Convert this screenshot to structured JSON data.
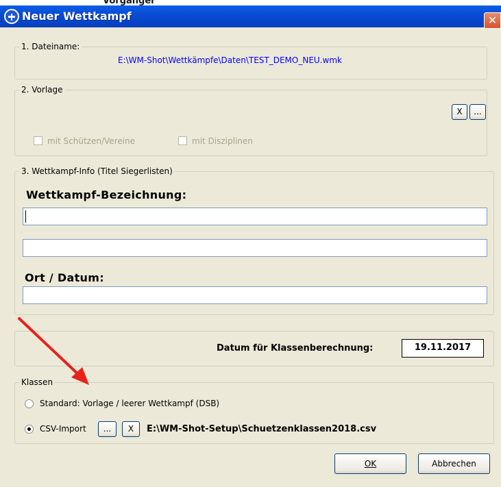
{
  "title_bar": {
    "title": "Neuer Wettkampf",
    "add_icon": "plus-circle-icon",
    "close_icon": "close-icon",
    "close_glyph": "✕",
    "top_cut_text": "Vorgänger"
  },
  "section1": {
    "legend": "1. Dateiname:",
    "path": "E:\\WM-Shot\\Wettkämpfe\\Daten\\TEST_DEMO_NEU.wmk",
    "path_color": "#0000ff"
  },
  "section2": {
    "legend": "2. Vorlage",
    "clear_button": "X",
    "browse_button": "...",
    "checkbox_shooters": "mit Schützen/Vereine",
    "checkbox_disciplines": "mit Disziplinen"
  },
  "section3": {
    "legend": "3. Wettkampf-Info (Titel Siegerlisten)",
    "name_heading": "Wettkampf-Bezeichnung:",
    "name_line1": "",
    "name_line2": "",
    "place_date_heading": "Ort / Datum:",
    "place_date_value": ""
  },
  "class_date": {
    "label": "Datum für Klassenberechnung:",
    "value": "19.11.2017"
  },
  "classes": {
    "legend": "Klassen",
    "option_standard": "Standard: Vorlage / leerer Wettkampf (DSB)",
    "option_csv": "CSV-Import",
    "selected": "CSV-Import",
    "browse_button": "...",
    "clear_button": "X",
    "csv_path": "E:\\WM-Shot-Setup\\Schuetzenklassen2018.csv"
  },
  "buttons": {
    "ok": "OK",
    "cancel": "Abbrechen"
  },
  "annotation": {
    "arrow_color": "#e8221a"
  }
}
